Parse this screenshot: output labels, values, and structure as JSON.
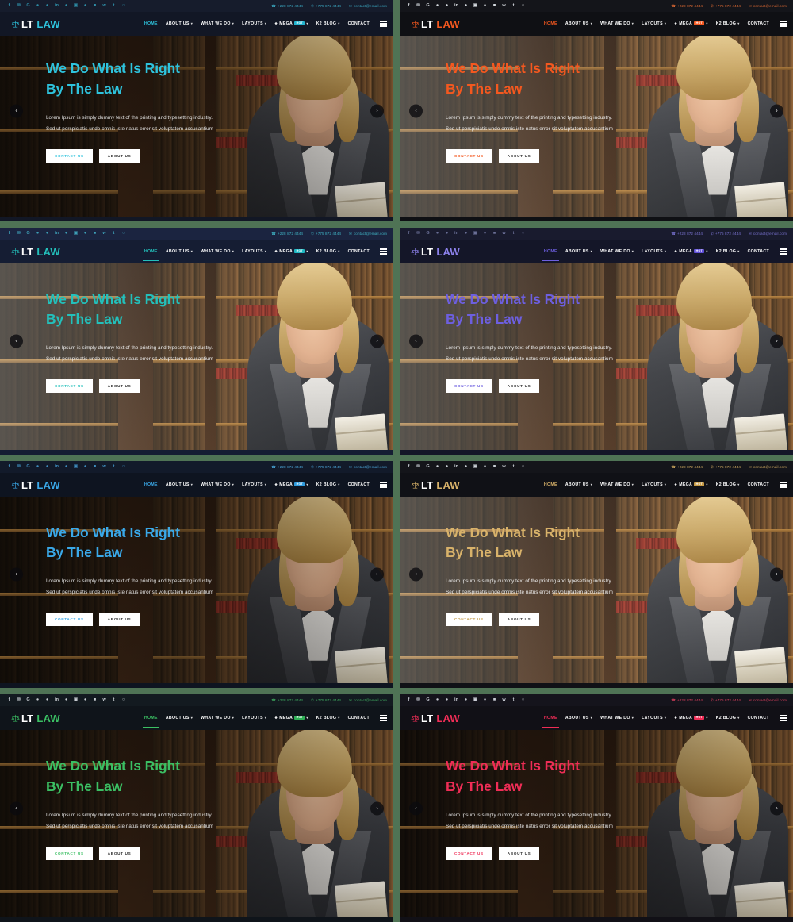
{
  "topbar": {
    "social_icons": [
      "facebook-icon",
      "twitter-icon",
      "google-plus-icon",
      "pinterest-icon",
      "dribbble-icon",
      "linkedin-icon",
      "behance-icon",
      "instagram-icon",
      "flickr-icon",
      "rss-icon",
      "vk-icon",
      "tumblr-icon",
      "whatsapp-icon"
    ],
    "phone1": "+228 872 4444",
    "phone2": "+775 872 4444",
    "email": "contact@email.com",
    "phone_icon": "phone-icon",
    "mobile_icon": "mobile-icon",
    "email_icon": "envelope-icon"
  },
  "logo": {
    "mark": "scales-of-justice-icon",
    "primary": "LT",
    "secondary": "LAW"
  },
  "nav": [
    {
      "label": "HOME",
      "caret": false,
      "active": true
    },
    {
      "label": "ABOUT US",
      "caret": true,
      "active": false
    },
    {
      "label": "WHAT WE DO",
      "caret": true,
      "active": false
    },
    {
      "label": "LAYOUTS",
      "caret": true,
      "active": false
    },
    {
      "label": "MEGA",
      "caret": true,
      "active": false,
      "badge": "HOT",
      "icon": "grid-icon"
    },
    {
      "label": "K2 BLOG",
      "caret": true,
      "active": false
    },
    {
      "label": "CONTACT",
      "caret": false,
      "active": false
    }
  ],
  "hero": {
    "title_line1": "We Do What Is Right",
    "title_line2": "By The Law",
    "sub_line1": "Lorem Ipsum is simply dummy text of the printing and typesetting industry.",
    "sub_line2": "Sed ut perspiciatis unde omnis iste natus error sit voluptatem accusantium",
    "btn_primary": "CONTACT US",
    "btn_secondary": "ABOUT US",
    "arrow_prev": "‹",
    "arrow_next": "›"
  },
  "page": {
    "background": "#4f7355"
  },
  "variants": [
    {
      "id": "v1",
      "accent": "#2ec3dd",
      "logo_law": "#2ec3dd",
      "topbar_bg": "#161c2c",
      "nav_bg": "#121725",
      "social": "#2e8fa8",
      "contact": "#3aa7c0",
      "overlay": "rgba(14,10,8,0.30)",
      "title": "#2ec3dd",
      "btn_text": "#2ec3dd",
      "badge": "#24b5d0",
      "hero_dark": true
    },
    {
      "id": "v2",
      "accent": "#f4581f",
      "logo_law": "#f4581f",
      "topbar_bg": "#14151a",
      "nav_bg": "#0f1014",
      "social": "#d8dde2",
      "contact": "#e06a33",
      "overlay": "rgba(255,252,245,0.12)",
      "title": "#f4581f",
      "btn_text": "#f4581f",
      "badge": "#f4581f",
      "hero_dark": false
    },
    {
      "id": "v3",
      "accent": "#23c0bb",
      "logo_law": "#23c0bb",
      "topbar_bg": "#1b2440",
      "nav_bg": "#151d33",
      "social": "#3ea0b8",
      "contact": "#3fb3c4",
      "overlay": "rgba(8,8,10,0.18)",
      "title": "#23c0bb",
      "btn_text": "#23c0bb",
      "badge": "#1fb9c4",
      "hero_dark": false
    },
    {
      "id": "v4",
      "accent": "#6d5fe0",
      "logo_law": "#8d82ec",
      "topbar_bg": "#191b2e",
      "nav_bg": "#141628",
      "social": "#6a6f96",
      "contact": "#7b74d4",
      "overlay": "rgba(12,10,22,0.22)",
      "title": "#6d5fe0",
      "btn_text": "#6d5fe0",
      "badge": "#5f4fd8",
      "hero_dark": false
    },
    {
      "id": "v5",
      "accent": "#3aa8e8",
      "logo_law": "#3aa8e8",
      "topbar_bg": "#121a2a",
      "nav_bg": "#0e1420",
      "social": "#3f8ec0",
      "contact": "#4aa5d8",
      "overlay": "rgba(10,8,6,0.26)",
      "title": "#3aa8e8",
      "btn_text": "#3aa8e8",
      "badge": "#2f9bdd",
      "hero_dark": true
    },
    {
      "id": "v6",
      "accent": "#d8b26a",
      "logo_law": "#d8b26a",
      "topbar_bg": "#14151a",
      "nav_bg": "#101116",
      "social": "#cbd0d6",
      "contact": "#d0a95f",
      "overlay": "rgba(255,250,240,0.13)",
      "title": "#d8b26a",
      "btn_text": "#c49c4c",
      "badge": "#c69a45",
      "hero_dark": false
    },
    {
      "id": "v7",
      "accent": "#3bbf63",
      "logo_law": "#3bbf63",
      "topbar_bg": "#131a20",
      "nav_bg": "#0f141a",
      "social": "#c8cdd2",
      "contact": "#3fae60",
      "overlay": "rgba(10,9,7,0.24)",
      "title": "#3bbf63",
      "btn_text": "#3bbf63",
      "badge": "#2fae55",
      "hero_dark": true
    },
    {
      "id": "v8",
      "accent": "#ef2d56",
      "logo_law": "#ef2d56",
      "topbar_bg": "#15141c",
      "nav_bg": "#111016",
      "social": "#c9ccd4",
      "contact": "#e0405f",
      "overlay": "rgba(10,8,10,0.28)",
      "title": "#ef2d56",
      "btn_text": "#ef2d56",
      "badge": "#ef2d56",
      "hero_dark": true
    }
  ]
}
